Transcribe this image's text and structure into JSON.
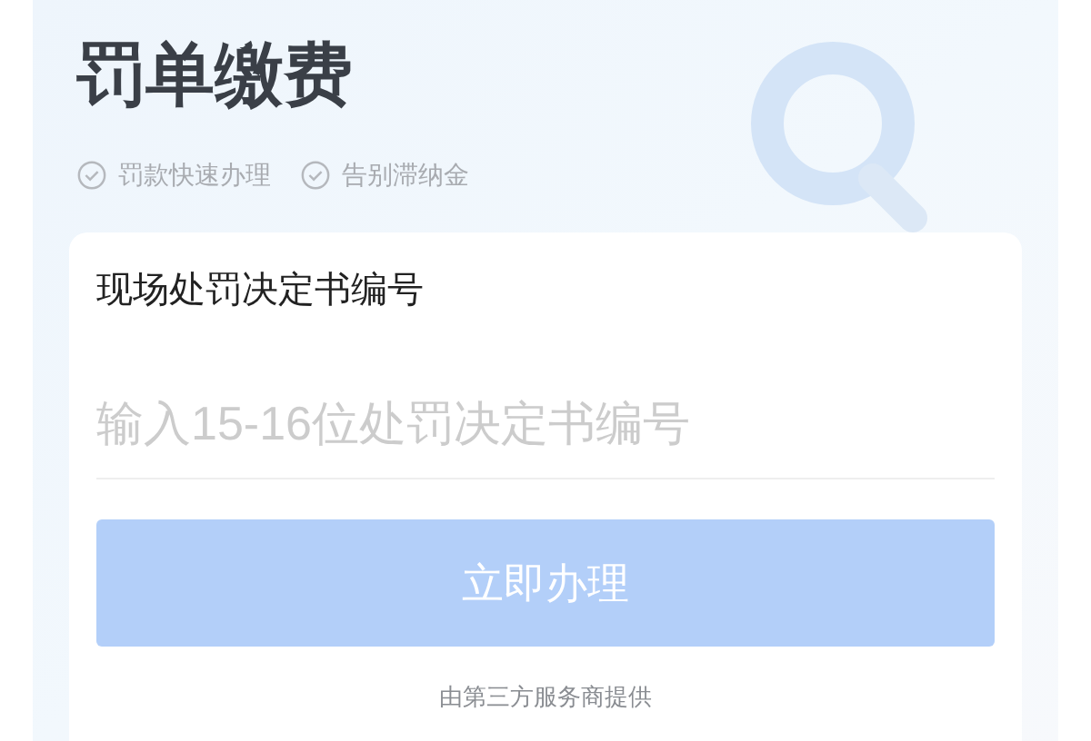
{
  "header": {
    "title": "罚单缴费",
    "features": [
      "罚款快速办理",
      "告别滞纳金"
    ]
  },
  "form": {
    "label": "现场处罚决定书编号",
    "input": {
      "placeholder": "输入15-16位处罚决定书编号"
    },
    "button": {
      "label": "立即办理",
      "disabled": true
    },
    "footer": "由第三方服务商提供"
  }
}
